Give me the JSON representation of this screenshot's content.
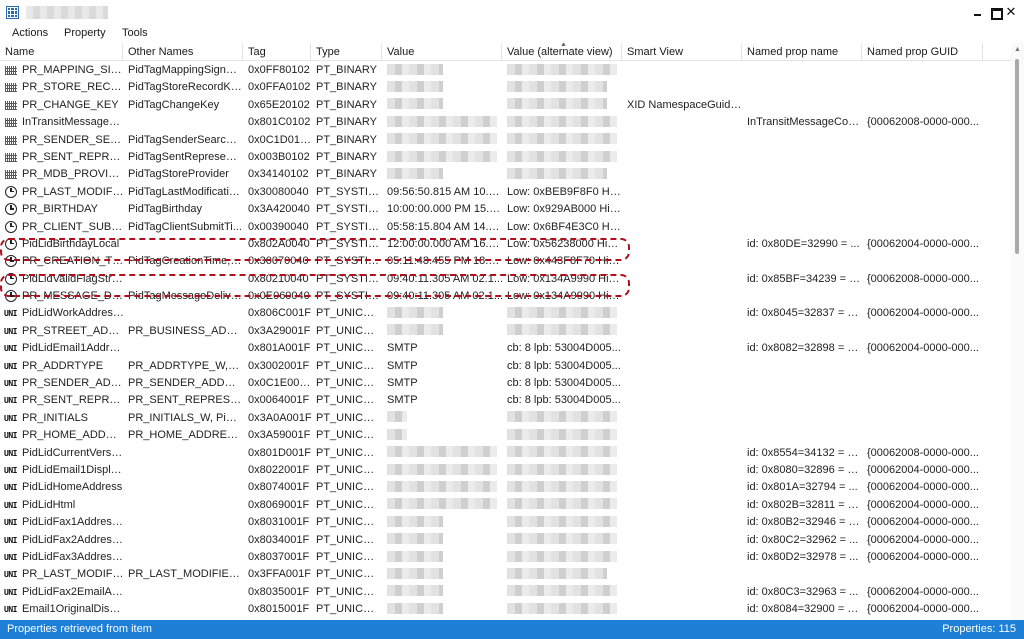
{
  "menu": {
    "actions": "Actions",
    "property": "Property",
    "tools": "Tools"
  },
  "columns": {
    "name": "Name",
    "other": "Other Names",
    "tag": "Tag",
    "type": "Type",
    "value": "Value",
    "alt": "Value (alternate view)",
    "smart": "Smart View",
    "npn": "Named prop name",
    "guid": "Named prop GUID"
  },
  "rows": [
    {
      "icon": "binary-icon",
      "name": "PR_MAPPING_SIGN...",
      "other": "PidTagMappingSignat...",
      "tag": "0x0FF80102",
      "type": "PT_BINARY",
      "value": "",
      "alt": "",
      "smart": "",
      "npn": "",
      "guid": ""
    },
    {
      "icon": "binary-icon",
      "name": "PR_STORE_RECORD...",
      "other": "PidTagStoreRecordKey",
      "tag": "0x0FFA0102",
      "type": "PT_BINARY",
      "value": "",
      "alt": "",
      "smart": "",
      "npn": "",
      "guid": ""
    },
    {
      "icon": "binary-icon",
      "name": "PR_CHANGE_KEY",
      "other": "PidTagChangeKey",
      "tag": "0x65E20102",
      "type": "PT_BINARY",
      "value": "",
      "alt": "",
      "smart": "XID NamespaceGuid ...",
      "npn": "",
      "guid": ""
    },
    {
      "icon": "binary-icon",
      "name": "InTransitMessageC...",
      "other": "",
      "tag": "0x801C0102",
      "type": "PT_BINARY",
      "value": "",
      "alt": "",
      "smart": "",
      "npn": "InTransitMessageCorr...",
      "guid": "{00062008-0000-000..."
    },
    {
      "icon": "binary-icon",
      "name": "PR_SENDER_SEARC...",
      "other": "PidTagSenderSearchK...",
      "tag": "0x0C1D0102",
      "type": "PT_BINARY",
      "value": "",
      "alt": "",
      "smart": "",
      "npn": "",
      "guid": ""
    },
    {
      "icon": "binary-icon",
      "name": "PR_SENT_REPRESE...",
      "other": "PidTagSentRepresenti...",
      "tag": "0x003B0102",
      "type": "PT_BINARY",
      "value": "",
      "alt": "",
      "smart": "",
      "npn": "",
      "guid": ""
    },
    {
      "icon": "binary-icon",
      "name": "PR_MDB_PROVIDER",
      "other": "PidTagStoreProvider",
      "tag": "0x34140102",
      "type": "PT_BINARY",
      "value": "",
      "alt": "",
      "smart": "",
      "npn": "",
      "guid": ""
    },
    {
      "icon": "clock-icon",
      "name": "PR_LAST_MODIFIC...",
      "other": "PidTagLastModificatio...",
      "tag": "0x30080040",
      "type": "PT_SYSTIME",
      "value": "09:56:50.815 AM 10.0...",
      "alt": "Low: 0xBEB9F8F0 Hig...",
      "smart": "",
      "npn": "",
      "guid": ""
    },
    {
      "icon": "clock-icon",
      "name": "PR_BIRTHDAY",
      "other": "PidTagBirthday",
      "tag": "0x3A420040",
      "type": "PT_SYSTIME",
      "value": "10:00:00.000 PM 15.1...",
      "alt": "Low: 0x929AB000 Hig...",
      "smart": "",
      "npn": "",
      "guid": ""
    },
    {
      "icon": "clock-icon",
      "name": "PR_CLIENT_SUBMIT...",
      "other": "PidTagClientSubmitTi...",
      "tag": "0x00390040",
      "type": "PT_SYSTIME",
      "value": "05:58:15.804 AM 14.0...",
      "alt": "Low: 0x6BF4E3C0 Hig...",
      "smart": "",
      "npn": "",
      "guid": ""
    },
    {
      "icon": "clock-icon",
      "name": "PidLidBirthdayLocal",
      "other": "",
      "tag": "0x802A0040",
      "type": "PT_SYSTIME",
      "value": "12:00:00.000 AM 16.1...",
      "alt": "Low: 0x56238000 Hig...",
      "smart": "",
      "npn": "id: 0x80DE=32990 = ...",
      "guid": "{00062004-0000-000..."
    },
    {
      "icon": "clock-icon",
      "name": "PR_CREATION_TIME",
      "other": "PidTagCreationTime, p...",
      "tag": "0x30070040",
      "type": "PT_SYSTIME",
      "value": "05:11:48.455 PM 18.0...",
      "alt": "Low: 0x443F8F70 Hig...",
      "smart": "",
      "npn": "",
      "guid": ""
    },
    {
      "icon": "clock-icon",
      "name": "PidLidValidFlagStrin...",
      "other": "",
      "tag": "0x80210040",
      "type": "PT_SYSTIME",
      "value": "09:40:11.305 AM 02.1...",
      "alt": "Low: 0x134A9990 Hig...",
      "smart": "",
      "npn": "id: 0x85BF=34239 = P...",
      "guid": "{00062008-0000-000..."
    },
    {
      "icon": "clock-icon",
      "name": "PR_MESSAGE_DELI...",
      "other": "PidTagMessageDeliver...",
      "tag": "0x0E060040",
      "type": "PT_SYSTIME",
      "value": "09:40:11.305 AM 02.1...",
      "alt": "Low: 0x134A9990 Hig...",
      "smart": "",
      "npn": "",
      "guid": ""
    },
    {
      "icon": "unicode-icon",
      "name": "PidLidWorkAddress...",
      "other": "",
      "tag": "0x806C001F",
      "type": "PT_UNICODE",
      "value": "",
      "alt": "",
      "smart": "",
      "npn": "id: 0x8045=32837 = P...",
      "guid": "{00062004-0000-000..."
    },
    {
      "icon": "unicode-icon",
      "name": "PR_STREET_ADDRE...",
      "other": "PR_BUSINESS_ADDRE...",
      "tag": "0x3A29001F",
      "type": "PT_UNICODE",
      "value": "",
      "alt": "",
      "smart": "",
      "npn": "",
      "guid": ""
    },
    {
      "icon": "unicode-icon",
      "name": "PidLidEmail1Addre...",
      "other": "",
      "tag": "0x801A001F",
      "type": "PT_UNICODE",
      "value": "SMTP",
      "alt": "cb: 8 lpb: 53004D005...",
      "smart": "",
      "npn": "id: 0x8082=32898 = P...",
      "guid": "{00062004-0000-000..."
    },
    {
      "icon": "unicode-icon",
      "name": "PR_ADDRTYPE",
      "other": "PR_ADDRTYPE_W, Pid...",
      "tag": "0x3002001F",
      "type": "PT_UNICODE",
      "value": "SMTP",
      "alt": "cb: 8 lpb: 53004D005...",
      "smart": "",
      "npn": "",
      "guid": ""
    },
    {
      "icon": "unicode-icon",
      "name": "PR_SENDER_ADDR...",
      "other": "PR_SENDER_ADDRTY...",
      "tag": "0x0C1E001F",
      "type": "PT_UNICODE",
      "value": "SMTP",
      "alt": "cb: 8 lpb: 53004D005...",
      "smart": "",
      "npn": "",
      "guid": ""
    },
    {
      "icon": "unicode-icon",
      "name": "PR_SENT_REPRESE...",
      "other": "PR_SENT_REPRESENTI...",
      "tag": "0x0064001F",
      "type": "PT_UNICODE",
      "value": "SMTP",
      "alt": "cb: 8 lpb: 53004D005...",
      "smart": "",
      "npn": "",
      "guid": ""
    },
    {
      "icon": "unicode-icon",
      "name": "PR_INITIALS",
      "other": "PR_INITIALS_W, PidTa...",
      "tag": "0x3A0A001F",
      "type": "PT_UNICODE",
      "value": "",
      "alt": "",
      "smart": "",
      "npn": "",
      "guid": ""
    },
    {
      "icon": "unicode-icon",
      "name": "PR_HOME_ADDRES...",
      "other": "PR_HOME_ADDRESS_...",
      "tag": "0x3A59001F",
      "type": "PT_UNICODE",
      "value": "",
      "alt": "",
      "smart": "",
      "npn": "",
      "guid": ""
    },
    {
      "icon": "unicode-icon",
      "name": "PidLidCurrentVersio...",
      "other": "",
      "tag": "0x801D001F",
      "type": "PT_UNICODE",
      "value": "",
      "alt": "",
      "smart": "",
      "npn": "id: 0x8554=34132 = P...",
      "guid": "{00062008-0000-000..."
    },
    {
      "icon": "unicode-icon",
      "name": "PidLidEmail1Displa...",
      "other": "",
      "tag": "0x8022001F",
      "type": "PT_UNICODE",
      "value": "",
      "alt": "",
      "smart": "",
      "npn": "id: 0x8080=32896 = P...",
      "guid": "{00062004-0000-000..."
    },
    {
      "icon": "unicode-icon",
      "name": "PidLidHomeAddress",
      "other": "",
      "tag": "0x8074001F",
      "type": "PT_UNICODE",
      "value": "",
      "alt": "",
      "smart": "",
      "npn": "id: 0x801A=32794 = ...",
      "guid": "{00062004-0000-000..."
    },
    {
      "icon": "unicode-icon",
      "name": "PidLidHtml",
      "other": "",
      "tag": "0x8069001F",
      "type": "PT_UNICODE",
      "value": "",
      "alt": "",
      "smart": "",
      "npn": "id: 0x802B=32811 = P...",
      "guid": "{00062004-0000-000..."
    },
    {
      "icon": "unicode-icon",
      "name": "PidLidFax1Address...",
      "other": "",
      "tag": "0x8031001F",
      "type": "PT_UNICODE",
      "value": "",
      "alt": "",
      "smart": "",
      "npn": "id: 0x80B2=32946 = P...",
      "guid": "{00062004-0000-000..."
    },
    {
      "icon": "unicode-icon",
      "name": "PidLidFax2Address...",
      "other": "",
      "tag": "0x8034001F",
      "type": "PT_UNICODE",
      "value": "",
      "alt": "",
      "smart": "",
      "npn": "id: 0x80C2=32962 = ...",
      "guid": "{00062004-0000-000..."
    },
    {
      "icon": "unicode-icon",
      "name": "PidLidFax3Address...",
      "other": "",
      "tag": "0x8037001F",
      "type": "PT_UNICODE",
      "value": "",
      "alt": "",
      "smart": "",
      "npn": "id: 0x80D2=32978 = ...",
      "guid": "{00062004-0000-000..."
    },
    {
      "icon": "unicode-icon",
      "name": "PR_LAST_MODIFIE...",
      "other": "PR_LAST_MODIFIER_...",
      "tag": "0x3FFA001F",
      "type": "PT_UNICODE",
      "value": "",
      "alt": "",
      "smart": "",
      "npn": "",
      "guid": ""
    },
    {
      "icon": "unicode-icon",
      "name": "PidLidFax2EmailAd...",
      "other": "",
      "tag": "0x8035001F",
      "type": "PT_UNICODE",
      "value": "",
      "alt": "",
      "smart": "",
      "npn": "id: 0x80C3=32963 = ...",
      "guid": "{00062004-0000-000..."
    },
    {
      "icon": "unicode-icon",
      "name": "Email1OriginalDispl...",
      "other": "",
      "tag": "0x8015001F",
      "type": "PT_UNICODE",
      "value": "",
      "alt": "",
      "smart": "",
      "npn": "id: 0x8084=32900 = E...",
      "guid": "{00062004-0000-000..."
    }
  ],
  "blurred": {
    "0": [
      "b1",
      "b3"
    ],
    "1": [
      "b1",
      "b2"
    ],
    "2": [
      "b1",
      "b2"
    ],
    "3": [
      "b3",
      "b3"
    ],
    "4": [
      "b3",
      "b3"
    ],
    "5": [
      "b3",
      "b3"
    ],
    "6": [
      "b1",
      "b2"
    ],
    "14": [
      "b1",
      "b3"
    ],
    "15": [
      "b1",
      "b3"
    ],
    "20": [
      "b4",
      "b3"
    ],
    "21": [
      "b4",
      "b3"
    ],
    "22": [
      "b3",
      "b3"
    ],
    "23": [
      "b3",
      "b3"
    ],
    "24": [
      "b3",
      "b3"
    ],
    "25": [
      "b3",
      "b3"
    ],
    "26": [
      "b1",
      "b3"
    ],
    "27": [
      "b1",
      "b3"
    ],
    "28": [
      "b1",
      "b3"
    ],
    "29": [
      "b1",
      "b2"
    ],
    "30": [
      "b1",
      "b3"
    ],
    "31": [
      "b1",
      "b3"
    ]
  },
  "highlighted_rows": [
    8,
    9,
    10
  ],
  "status": {
    "left": "Properties retrieved from item",
    "right": "Properties: 115"
  },
  "colors": {
    "status_bar": "#1e7fd6",
    "highlight": "#b0101c"
  }
}
